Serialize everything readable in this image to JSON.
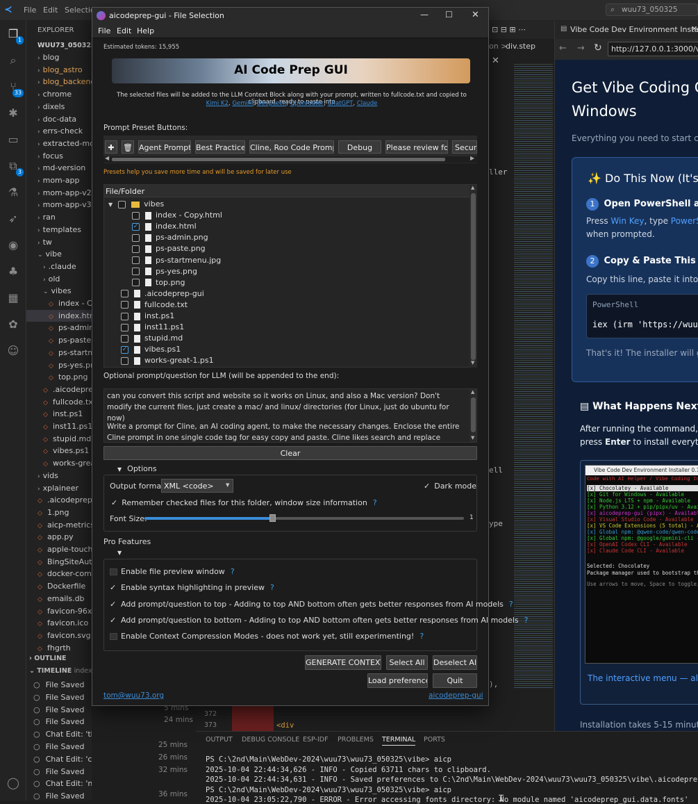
{
  "vscode": {
    "menu": [
      "File",
      "Edit",
      "Selectio"
    ],
    "search": "wuu73_050325",
    "explorer_title": "EXPLORER",
    "root": "WUU73_050325",
    "tree": [
      "blog",
      "blog_astro",
      "blog_backend",
      "chrome",
      "dixels",
      "doc-data",
      "errs-check",
      "extracted-md",
      "focus",
      "md-version",
      "mom-app",
      "mom-app-v2",
      "mom-app-v3",
      "ran",
      "templates",
      "tw",
      "vibe",
      ".claude",
      "old",
      "vibes",
      "index - Cop",
      "index.html",
      "ps-admin.p",
      "ps-paste.pn",
      "ps-startmer",
      "ps-yes.png",
      "top.png",
      ".aicodeprep-",
      "fullcode.txt",
      "inst.ps1",
      "inst11.ps1",
      "stupid.md",
      "vibes.ps1",
      "works-great-",
      "vids",
      "xplaineer",
      ".aicodeprep-gu",
      "1.png",
      "aicp-metrics.dl",
      "app.py",
      "apple-touch-ic",
      "BingSiteAuth.x",
      "docker-compc",
      "Dockerfile",
      "emails.db",
      "favicon-96x96",
      "favicon.ico",
      "favicon.svg",
      "fhgrth"
    ],
    "outline": "OUTLINE",
    "timeline": "TIMELINE",
    "timeline_file": "index.ht",
    "timeline_items": [
      "File Saved",
      "File Saved",
      "File Saved",
      "File Saved",
      "Chat Edit: 'the button to show the powe...",
      "File Saved",
      "Chat Edit: 'can you add somethin...",
      "File Saved",
      "Chat Edit: 'need a minor tweak/add to t...",
      "File Saved"
    ],
    "timeline_times": [
      "",
      "",
      "5 mins",
      "24 mins",
      "",
      "25 mins",
      "26 mins",
      "32 mins",
      "",
      "36 mins"
    ],
    "editor_breadcrumb": "div.step",
    "editor_frag": [
      "on >",
      "ller",
      "ell",
      "ype",
      "),"
    ],
    "line_numbers": [
      "372",
      "373"
    ],
    "line_code": "<div",
    "bottom_tabs": [
      "OUTPUT",
      "DEBUG CONSOLE",
      "ESP-IDF",
      "PROBLEMS",
      "TERMINAL",
      "PORTS"
    ],
    "terminal": [
      "PS C:\\2nd\\Main\\WebDev-2024\\wuu73\\wuu73_050325\\vibe> aicp",
      "2025-10-04 22:44:34,626 - INFO - Copied 63711 chars to clipboard.",
      "2025-10-04 22:44:34,631 - INFO - Saved preferences to C:\\2nd\\Main\\WebDev-2024\\wuu73\\wuu73_050325\\vibe\\.aicodeprep-gui",
      "PS C:\\2nd\\Main\\WebDev-2024\\wuu73\\wuu73_050325\\vibe> aicp",
      "2025-10-04 23:05:22,790 - ERROR - Error accessing fonts directory: No module named 'aicodeprep_gui.data.fonts'"
    ]
  },
  "browser": {
    "tab": "Vibe Code Dev Environment Installer",
    "url": "http://127.0.0.1:3000/vibe/",
    "h1a": "Get Vibe Coding C",
    "h1b": "Windows",
    "sub": "Everything you need to start co",
    "card_title": "✨ Do This Now (It's",
    "step1": "Open PowerShell as A",
    "step1_text_a": "Press ",
    "step1_key": "Win Key",
    "step1_text_b": ", type ",
    "step1_ps": "PowerS",
    "step1_text_c": "when prompted.",
    "step2": "Copy & Paste This Co",
    "step2_text": "Copy this line, paste it into P",
    "code_label": "PowerShell",
    "code": "iex (irm 'https://wuu7",
    "thats_it": "That's it! The installer will gui",
    "next_title": "What Happens Next?",
    "next_text_a": "After running the command, y",
    "next_text_b": "press ",
    "next_enter": "Enter",
    "next_text_c": " to install everyth",
    "shot_title": "Vibe Code Dev Environment Installer 0.1",
    "shot_header": "Code with AI Helper / Vibe Coding In",
    "shot_items": [
      "[x] Chocolatey - Available",
      "[x] Git for Windows - Available",
      "[x] Node.js LTS + npm - Available",
      "[x] Python 3.12 + pip/pipx/uv - Avail",
      "[x] aicodeprep-gui (pipx) - Availabl",
      "[x] Visual Studio Code - Available",
      "[x] VS Code Extensions (5 total) - Av",
      "[x] Global npm: @qwen-code/qwen-code",
      "[x] Global npm: @google/gemini-cli -",
      "[x] OpenAI Codex CLI - Available",
      "[x] Claude Code CLI - Available"
    ],
    "shot_selected": "Selected: Chocolatey",
    "shot_desc": "Package manager used to bootstrap the",
    "shot_hint": "Use arrows to move, Space to toggle,",
    "caption": "The interactive menu — all too",
    "install_time": "Installation takes 5-15 minutes"
  },
  "dialog": {
    "title": "aicodeprep-gui - File Selection",
    "menu": [
      "File",
      "Edit",
      "Help"
    ],
    "tokens": "Estimated tokens: 15,955",
    "banner": "AI Code Prep GUI",
    "desc": "The selected files will be added to the LLM Context Block along with your prompt, written to fullcode.txt and copied to clipboard, ready to paste into",
    "links": [
      "Kimi K2",
      "Gemini",
      "Deepseek",
      "Openrouter",
      "ChatGPT",
      "Claude"
    ],
    "preset_label": "Prompt Preset Buttons:",
    "presets": [
      "Agent Prompt",
      "Best Practices",
      "Cline, Roo Code Prompt",
      "Debug",
      "Please review for",
      "Securit"
    ],
    "preset_help": "Presets help you save more time and will be saved for later use",
    "tree_header": "File/Folder",
    "tree": [
      {
        "name": "vibes",
        "level": 0,
        "folder": true,
        "checked": false
      },
      {
        "name": "index - Copy.html",
        "level": 1,
        "checked": false
      },
      {
        "name": "index.html",
        "level": 1,
        "checked": true
      },
      {
        "name": "ps-admin.png",
        "level": 1,
        "checked": false
      },
      {
        "name": "ps-paste.png",
        "level": 1,
        "checked": false
      },
      {
        "name": "ps-startmenu.jpg",
        "level": 1,
        "checked": false
      },
      {
        "name": "ps-yes.png",
        "level": 1,
        "checked": false
      },
      {
        "name": "top.png",
        "level": 1,
        "checked": false
      },
      {
        "name": ".aicodeprep-gui",
        "level": 0,
        "checked": false
      },
      {
        "name": "fullcode.txt",
        "level": 0,
        "checked": false
      },
      {
        "name": "inst.ps1",
        "level": 0,
        "checked": false
      },
      {
        "name": "inst11.ps1",
        "level": 0,
        "checked": false
      },
      {
        "name": "stupid.md",
        "level": 0,
        "checked": false
      },
      {
        "name": "vibes.ps1",
        "level": 0,
        "checked": true
      },
      {
        "name": "works-great-1.ps1",
        "level": 0,
        "checked": false
      }
    ],
    "prompt_label": "Optional prompt/question for LLM (will be appended to the end):",
    "prompt_text_1": "can you convert this script and website so it works on Linux, and also a Mac version? Don't modify the current files, just create a mac/ and linux/ directories (for Linux, just do ubuntu for now)",
    "prompt_text_2": "Write a prompt for Cline, an AI coding agent, to make the necessary changes. Enclose the entire Cline prompt in one single code tag for easy copy and paste. Cline likes search and replace blocks with just plain language with a",
    "clear": "Clear",
    "options_label": "Options",
    "output_format_label": "Output format:",
    "output_format": "XML <code>",
    "dark_mode": "Dark mode",
    "remember": "Remember checked files for this folder, window size information",
    "font_size_label": "Font Size:",
    "font_size_value": "1",
    "font_slider": 0.4,
    "pro_label": "Pro Features",
    "pro": [
      {
        "label": "Enable file preview window",
        "checked": false
      },
      {
        "label": "Enable syntax highlighting in preview",
        "checked": true
      },
      {
        "label": "Add prompt/question to top - Adding to top AND bottom often gets better responses from AI models",
        "checked": true
      },
      {
        "label": "Add prompt/question to bottom - Adding to top AND bottom often gets better responses from AI models",
        "checked": true
      },
      {
        "label": "Enable Context Compression Modes - does not work yet, still experimenting!",
        "checked": false
      }
    ],
    "generate": "GENERATE CONTEXT!",
    "select_all": "Select All",
    "deselect_all": "Deselect All",
    "load_prefs": "Load preferences",
    "quit": "Quit",
    "email": "tom@wuu73.org",
    "footer_link": "aicodeprep-gui"
  }
}
